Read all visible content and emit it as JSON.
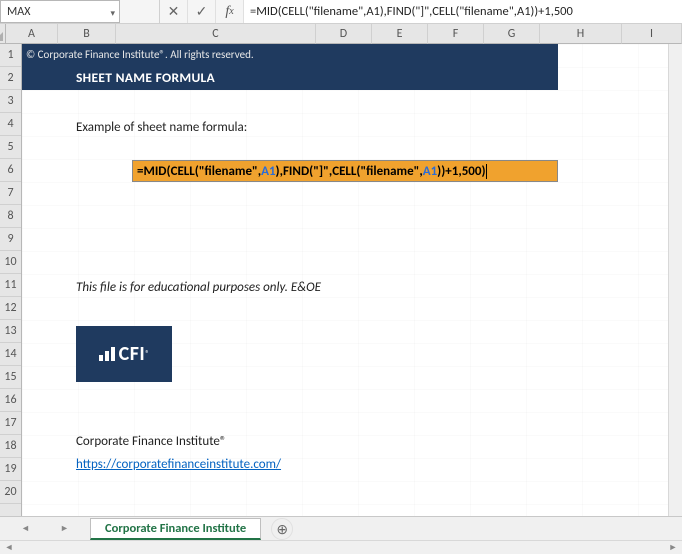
{
  "namebox": {
    "value": "MAX"
  },
  "formula_bar": {
    "text": "=MID(CELL(\"filename\",A1),FIND(\"]\",CELL(\"filename\",A1))+1,500"
  },
  "columns": [
    "A",
    "B",
    "C",
    "D",
    "E",
    "F",
    "G",
    "H",
    "I"
  ],
  "rows": [
    "1",
    "2",
    "3",
    "4",
    "5",
    "6",
    "7",
    "8",
    "9",
    "10",
    "11",
    "12",
    "13",
    "14",
    "15",
    "16",
    "17",
    "18",
    "19",
    "20"
  ],
  "header": {
    "copyright": "© Corporate Finance Institute®. All rights reserved.",
    "title": "SHEET NAME FORMULA"
  },
  "content": {
    "example_label": "Example of sheet name formula:",
    "formula_tokens": {
      "t1": "=MID",
      "t2": "(",
      "t3": "CELL",
      "t4": "(",
      "t5": "\"filename\"",
      "t6": ",",
      "t7": "A1",
      "t8": ")",
      "t9": ",",
      "t10": "FIND",
      "t11": "(",
      "t12": "\"]\"",
      "t13": ",",
      "t14": "CELL",
      "t15": "(",
      "t16": "\"filename\"",
      "t17": ",",
      "t18": "A1",
      "t19": ")",
      "t20": ")",
      "t21": "+1,500",
      "t22": ")"
    },
    "disclaimer": "This file is for educational purposes only. E&OE",
    "logo_text": "CFI",
    "company_name": "Corporate Finance Institute®",
    "company_link": "https://corporatefinanceinstitute.com/"
  },
  "sheet_tab": {
    "name": "Corporate Finance Institute"
  }
}
